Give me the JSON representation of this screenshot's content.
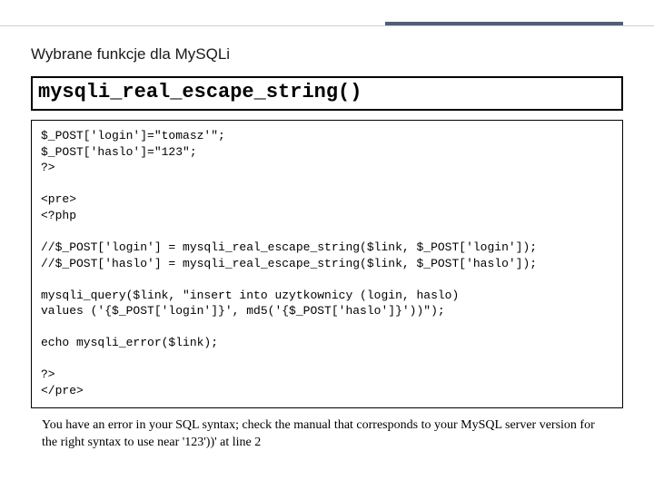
{
  "section_title": "Wybrane funkcje dla MySQLi",
  "function_name": "mysqli_real_escape_string()",
  "code_lines": [
    "$_POST['login']=\"tomasz'\";",
    "$_POST['haslo']=\"123\";",
    "?>",
    "",
    "<pre>",
    "<?php",
    "",
    "//$_POST['login'] = mysqli_real_escape_string($link, $_POST['login']);",
    "//$_POST['haslo'] = mysqli_real_escape_string($link, $_POST['haslo']);",
    "",
    "mysqli_query($link, \"insert into uzytkownicy (login, haslo)",
    "values ('{$_POST['login']}', md5('{$_POST['haslo']}'))\");",
    "",
    "echo mysqli_error($link);",
    "",
    "?>",
    "</pre>"
  ],
  "error_message": "You have an error in your SQL syntax; check the manual that corresponds to your MySQL server version for the right syntax to use near '123'))' at line 2"
}
